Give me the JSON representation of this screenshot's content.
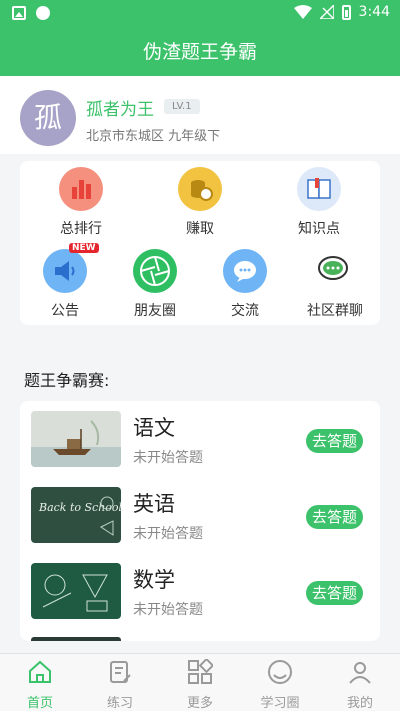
{
  "status_bar": {
    "time": "3:44"
  },
  "app": {
    "title": "伪渣题王争霸"
  },
  "profile": {
    "avatar_char": "孤",
    "name": "孤者为王",
    "level": "LV.1",
    "location": "北京市东城区  九年级下"
  },
  "quick_actions": [
    {
      "label": "总排行",
      "icon": "ranking-icon",
      "color": "#f58f7e"
    },
    {
      "label": "赚取",
      "icon": "coins-icon",
      "color": "#f2c341"
    },
    {
      "label": "知识点",
      "icon": "book-icon",
      "color": "#dde9f9"
    },
    {
      "label": "公告",
      "icon": "megaphone-icon",
      "color": "#6fb4f4",
      "badge": "NEW"
    },
    {
      "label": "朋友圈",
      "icon": "aperture-icon",
      "color": "#2fbf63"
    },
    {
      "label": "交流",
      "icon": "chat-bubble-icon",
      "color": "#6fb4f4"
    },
    {
      "label": "社区群聊",
      "icon": "group-chat-icon",
      "color": "#48b15a"
    }
  ],
  "competition": {
    "title": "题王争霸赛:",
    "subjects": [
      {
        "name": "语文",
        "status": "未开始答题",
        "button": "去答题",
        "image": "boat-painting"
      },
      {
        "name": "英语",
        "status": "未开始答题",
        "button": "去答题",
        "image": "chalkboard-back-to-school",
        "image_text": "Back to School"
      },
      {
        "name": "数学",
        "status": "未开始答题",
        "button": "去答题",
        "image": "chalkboard-math"
      }
    ]
  },
  "tabbar": [
    {
      "label": "首页",
      "icon": "home-icon",
      "active": true
    },
    {
      "label": "练习",
      "icon": "practice-icon",
      "active": false
    },
    {
      "label": "更多",
      "icon": "more-grid-icon",
      "active": false
    },
    {
      "label": "学习圈",
      "icon": "study-circle-icon",
      "active": false
    },
    {
      "label": "我的",
      "icon": "profile-icon",
      "active": false
    }
  ],
  "colors": {
    "primary": "#3cc26a",
    "badge_red": "#e5262f"
  }
}
